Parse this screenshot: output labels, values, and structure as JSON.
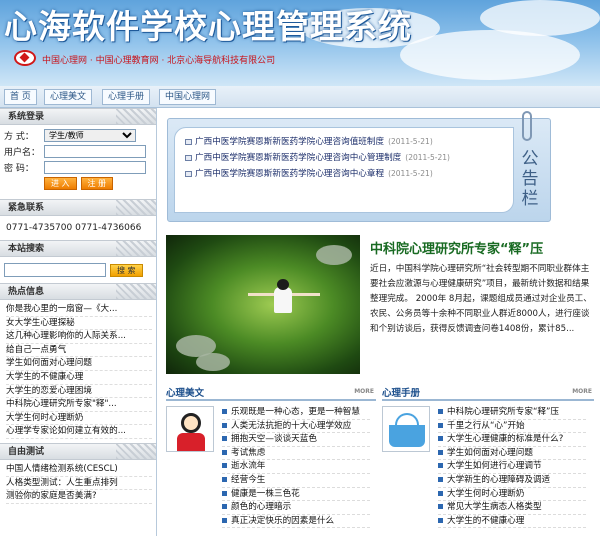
{
  "header": {
    "title": "心海软件学校心理管理系统",
    "sublinks": "中国心理网 · 中国心理教育网 · 北京心海导航科技有限公司"
  },
  "nav": {
    "tabs": [
      "首 页",
      "心理美文",
      "心理手册",
      "中国心理网"
    ]
  },
  "login": {
    "title": "系统登录",
    "mode_label": "方  式：",
    "mode_value": "学生/教师",
    "user_label": "用户名：",
    "pass_label": "密  码：",
    "login_btn": "进 入",
    "register_btn": "注 册"
  },
  "contact": {
    "title": "紧急联系",
    "phones": "0771-4735700  0771-4736066"
  },
  "site_search": {
    "title": "本站搜索",
    "button": "搜 索"
  },
  "hot": {
    "title": "热点信息",
    "items": [
      "你是我心里的一扇窗—《大...",
      "女大学生心理探秘",
      "这几种心理影响你的人际关系...",
      "给自己一点勇气",
      "学生如何面对心理问题",
      "大学生的不健康心理",
      "大学生的恋爱心理困境",
      "中科院心理研究所专家\"释\"...",
      "大学生何时心理断奶",
      "心理学专家论如何建立有效的..."
    ]
  },
  "selftest": {
    "title": "自由测试",
    "items": [
      "中国人情绪检测系统(CESCL)",
      "人格类型测试：人生重点排列",
      "测验你的家庭是否美满?"
    ]
  },
  "notice": {
    "board_label": "公告栏",
    "items": [
      {
        "text": "广西中医学院赛恩斯新医药学院心理咨询值班制度",
        "date": "(2011-5-21)"
      },
      {
        "text": "广西中医学院赛恩斯新医药学院心理咨询中心管理制度",
        "date": "(2011-5-21)"
      },
      {
        "text": "广西中医学院赛恩斯新医药学院心理咨询中心章程",
        "date": "(2011-5-21)"
      }
    ]
  },
  "featured": {
    "title": "中科院心理研究所专家“释”压",
    "body": "近日，中国科学院心理研究所“社会转型期不同职业群体主要社会应激源与心理健康研究”项目，最新统计数据和结果整理完成。 2000年 8月起，课题组成员通过对企业员工、农民、公务员等十余种不同职业人群近8000人，进行座谈和个别访谈后，获得反馈调查问卷1408份，累计85..."
  },
  "articles": {
    "title": "心理美文",
    "more": "MORE",
    "items": [
      "乐观既是一种心态，更是一种智慧",
      "人类无法抗拒的十大心理学效应",
      "拥抱天空—谈谈天蓝色",
      "考试焦虑",
      "逝水流年",
      "经营今生",
      "健康是一株三色花",
      "颜色的心理暗示",
      "真正决定快乐的因素是什么"
    ]
  },
  "handbook": {
    "title": "心理手册",
    "more": "MORE",
    "items": [
      "中科院心理研究所专家“释”压",
      "千里之行从“心”开始",
      "大学生心理健康的标准是什么?",
      "学生如何面对心理问题",
      "大学生如何进行心理调节",
      "大学新生的心理障碍及调适",
      "大学生何时心理断奶",
      "常见大学生病态人格类型",
      "大学生的不健康心理"
    ]
  },
  "colors": {
    "accent": "#186a22",
    "link": "#1c4f8c",
    "button": "#ee7d00"
  }
}
